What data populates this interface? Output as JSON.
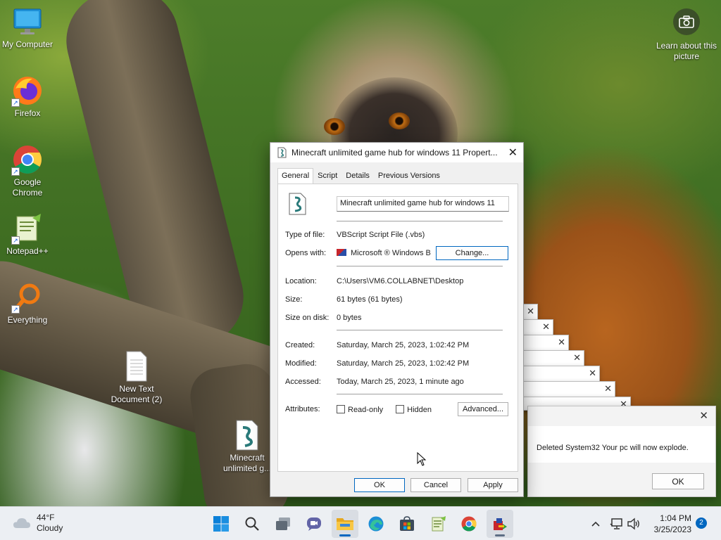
{
  "desktop": {
    "icons": [
      {
        "label": "My Computer",
        "icon": "monitor-icon"
      },
      {
        "label": "Firefox",
        "icon": "firefox-icon"
      },
      {
        "label": "Google Chrome",
        "icon": "chrome-icon"
      },
      {
        "label": "Notepad++",
        "icon": "notepadpp-icon"
      },
      {
        "label": "Everything",
        "icon": "everything-icon"
      },
      {
        "label": "New Text Document (2)",
        "icon": "text-file-icon"
      },
      {
        "label": "Minecraft unlimited g...",
        "icon": "vbs-script-icon"
      }
    ],
    "learn_label": "Learn about this picture"
  },
  "dialog": {
    "title": "Minecraft unlimited game hub for windows 11 Propert...",
    "tabs": [
      "General",
      "Script",
      "Details",
      "Previous Versions"
    ],
    "active_tab": "General",
    "file_name": "Minecraft unlimited game hub for windows 11",
    "type_label": "Type of file:",
    "type_value": "VBScript Script File (.vbs)",
    "opens_label": "Opens with:",
    "opens_value": "Microsoft ® Windows B",
    "change_button": "Change...",
    "location_label": "Location:",
    "location_value": "C:\\Users\\VM6.COLLABNET\\Desktop",
    "size_label": "Size:",
    "size_value": "61 bytes (61 bytes)",
    "size_disk_label": "Size on disk:",
    "size_disk_value": "0 bytes",
    "created_label": "Created:",
    "created_value": "Saturday, March 25, 2023, 1:02:42 PM",
    "modified_label": "Modified:",
    "modified_value": "Saturday, March 25, 2023, 1:02:42 PM",
    "accessed_label": "Accessed:",
    "accessed_value": "Today, March 25, 2023, 1 minute ago",
    "attributes_label": "Attributes:",
    "readonly_label": "Read-only",
    "hidden_label": "Hidden",
    "advanced_button": "Advanced...",
    "ok_button": "OK",
    "cancel_button": "Cancel",
    "apply_button": "Apply"
  },
  "message_box": {
    "text": "Deleted System32 Your pc will now explode.",
    "ok_button": "OK"
  },
  "taskbar": {
    "temperature": "44°F",
    "condition": "Cloudy",
    "time": "1:04 PM",
    "date": "3/25/2023",
    "notification_count": "2"
  },
  "colors": {
    "accent": "#0067c0",
    "taskbar_bg": "#eceff3",
    "dialog_bg": "#f0f0f0"
  }
}
